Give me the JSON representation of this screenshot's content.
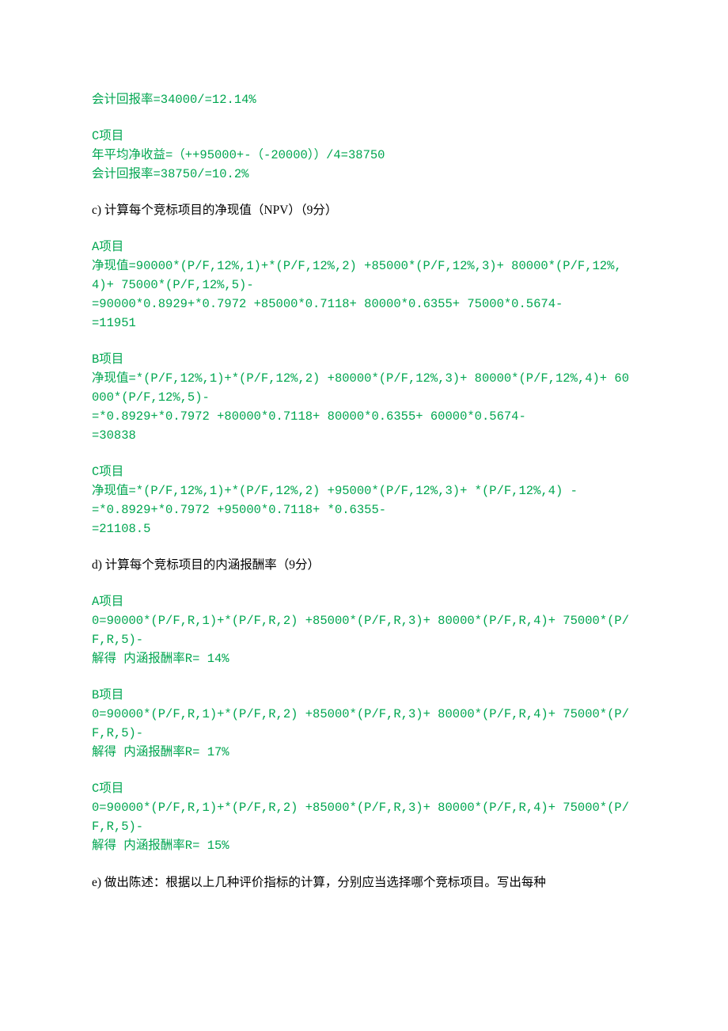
{
  "sections": [
    {
      "type": "answer",
      "lines": [
        "会计回报率=34000/=12.14%"
      ]
    },
    {
      "type": "answer",
      "lines": [
        "C项目",
        "年平均净收益=（++95000+-（-20000））/4=38750",
        "会计回报率=38750/=10.2%"
      ]
    },
    {
      "type": "question",
      "lines": [
        "c) 计算每个竞标项目的净现值（NPV）（9分）"
      ]
    },
    {
      "type": "answer",
      "lines": [
        "A项目",
        "净现值=90000*(P/F,12%,1)+*(P/F,12%,2) +85000*(P/F,12%,3)+ 80000*(P/F,12%,4)+ 75000*(P/F,12%,5)-",
        "=90000*0.8929+*0.7972 +85000*0.7118+ 80000*0.6355+ 75000*0.5674-",
        "=11951"
      ]
    },
    {
      "type": "answer",
      "lines": [
        "B项目",
        "净现值=*(P/F,12%,1)+*(P/F,12%,2) +80000*(P/F,12%,3)+ 80000*(P/F,12%,4)+ 60000*(P/F,12%,5)-",
        "=*0.8929+*0.7972 +80000*0.7118+ 80000*0.6355+ 60000*0.5674-",
        "=30838"
      ]
    },
    {
      "type": "answer",
      "lines": [
        "C项目",
        "净现值=*(P/F,12%,1)+*(P/F,12%,2) +95000*(P/F,12%,3)+ *(P/F,12%,4) -",
        "=*0.8929+*0.7972 +95000*0.7118+ *0.6355-",
        "=21108.5"
      ]
    },
    {
      "type": "question",
      "lines": [
        "d) 计算每个竞标项目的内涵报酬率（9分）"
      ]
    },
    {
      "type": "answer",
      "lines": [
        "A项目",
        "0=90000*(P/F,R,1)+*(P/F,R,2) +85000*(P/F,R,3)+ 80000*(P/F,R,4)+ 75000*(P/F,R,5)-",
        "解得 内涵报酬率R= 14%"
      ]
    },
    {
      "type": "answer",
      "lines": [
        "B项目",
        "0=90000*(P/F,R,1)+*(P/F,R,2) +85000*(P/F,R,3)+ 80000*(P/F,R,4)+ 75000*(P/F,R,5)-",
        "解得 内涵报酬率R= 17%"
      ]
    },
    {
      "type": "answer",
      "lines": [
        "C项目",
        "0=90000*(P/F,R,1)+*(P/F,R,2) +85000*(P/F,R,3)+ 80000*(P/F,R,4)+ 75000*(P/F,R,5)-",
        "解得 内涵报酬率R= 15%"
      ]
    },
    {
      "type": "spacer",
      "lines": [
        ""
      ]
    },
    {
      "type": "question",
      "lines": [
        "e) 做出陈述：根据以上几种评价指标的计算，分别应当选择哪个竞标项目。写出每种"
      ]
    }
  ]
}
